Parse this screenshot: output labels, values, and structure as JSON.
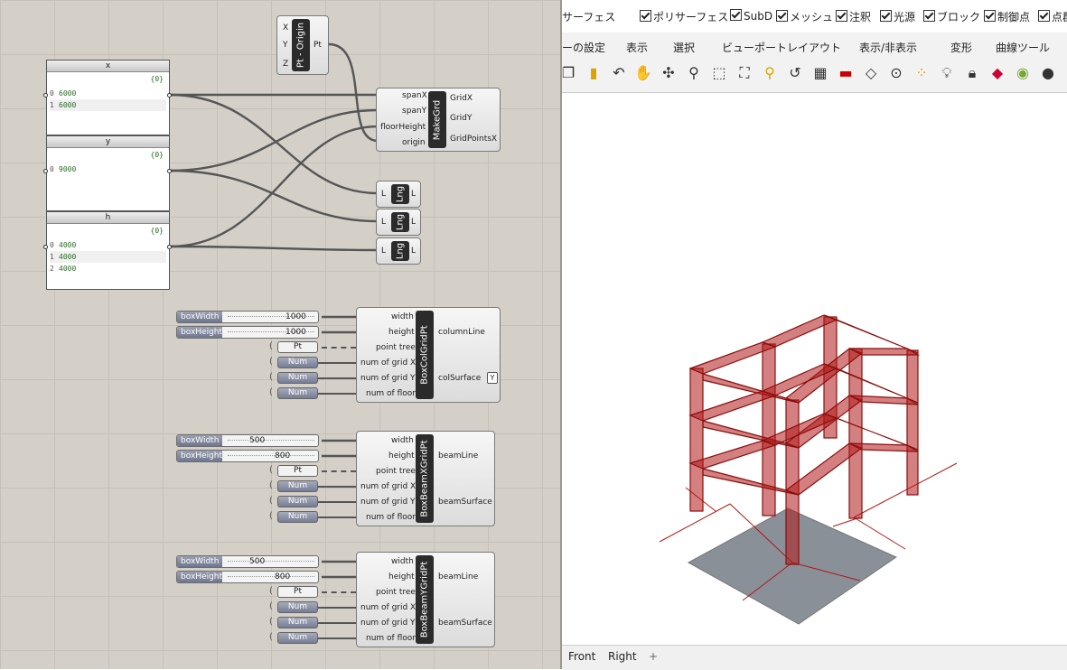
{
  "grasshopper": {
    "origin_component": {
      "name": "Pt - Origin",
      "inputs": [
        "X",
        "Y",
        "Z"
      ],
      "output": "Pt"
    },
    "panel_x": {
      "title": "x",
      "path": "{0}",
      "items": [
        {
          "i": "0",
          "v": "6000"
        },
        {
          "i": "1",
          "v": "6000"
        }
      ]
    },
    "panel_y": {
      "title": "y",
      "path": "{0}",
      "items": [
        {
          "i": "0",
          "v": "9000"
        }
      ]
    },
    "panel_h": {
      "title": "h",
      "path": "{0}",
      "items": [
        {
          "i": "0",
          "v": "4000"
        },
        {
          "i": "1",
          "v": "4000"
        },
        {
          "i": "2",
          "v": "4000"
        }
      ]
    },
    "makegrd": {
      "name": "MakeGrd",
      "inputs": [
        "spanX",
        "spanY",
        "floorHeight",
        "origin"
      ],
      "outputs": [
        "GridX",
        "GridY",
        "GridPointsX"
      ]
    },
    "lng": {
      "name": "Lng",
      "in": "L",
      "out": "L"
    },
    "col": {
      "name": "BoxColGridPt",
      "inputs": [
        "width",
        "height",
        "point tree",
        "num of grid X",
        "num of grid Y",
        "num of floor"
      ],
      "outputs": [
        "columnLine",
        "colSurface"
      ],
      "boxWidth": {
        "label": "boxWidth",
        "value": "1000"
      },
      "boxHeight": {
        "label": "boxHeight",
        "value": "1000"
      }
    },
    "beamx": {
      "name": "BoxBeamXGridPt",
      "inputs": [
        "width",
        "height",
        "point tree",
        "num of grid X",
        "num of grid Y",
        "num of floor"
      ],
      "outputs": [
        "beamLine",
        "beamSurface"
      ],
      "boxWidth": {
        "label": "boxWidth",
        "value": "500"
      },
      "boxHeight": {
        "label": "boxHeight",
        "value": "800"
      }
    },
    "beamy": {
      "name": "BoxBeamYGridPt",
      "inputs": [
        "width",
        "height",
        "point tree",
        "num of grid X",
        "num of grid Y",
        "num of floor"
      ],
      "outputs": [
        "beamLine",
        "beamSurface"
      ],
      "boxWidth": {
        "label": "boxWidth",
        "value": "500"
      },
      "boxHeight": {
        "label": "boxHeight",
        "value": "800"
      }
    },
    "tags": {
      "pt": "Pt",
      "num": "Num"
    }
  },
  "rhino": {
    "filters": [
      "サーフェス",
      "ポリサーフェス",
      "SubD",
      "メッシュ",
      "注釈",
      "光源",
      "ブロック",
      "制御点",
      "点群"
    ],
    "menus": [
      "ーの設定",
      "表示",
      "選択",
      "ビューポートレイアウト",
      "表示/非表示",
      "変形",
      "曲線ツール"
    ],
    "viewport_tabs": [
      "Front",
      "Right"
    ],
    "add_tab": "+",
    "colors": {
      "frame": "#b01818",
      "ground": "#8a9098",
      "axis": "#b01818"
    }
  }
}
